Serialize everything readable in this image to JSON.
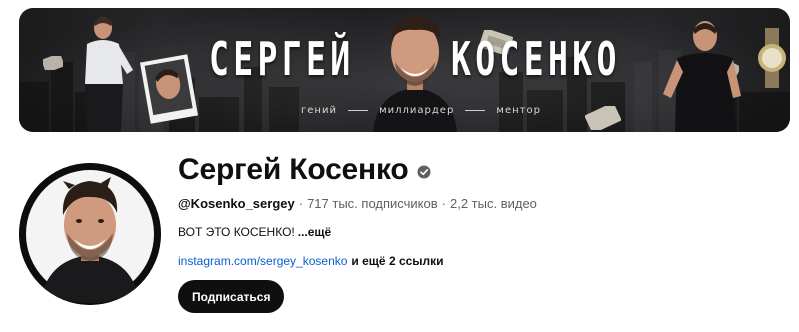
{
  "banner": {
    "title_first": "СЕРГЕЙ",
    "title_last": "КОСЕНКО",
    "tagline": [
      "гений",
      "миллиардер",
      "ментор"
    ]
  },
  "channel": {
    "name": "Сергей Косенко",
    "verified_icon": "verified-check-icon",
    "handle": "@Kosenko_sergey",
    "separator": "·",
    "subscribers": "717 тыс. подписчиков",
    "videos": "2,2 тыс. видео",
    "description": "ВОТ ЭТО КОСЕНКО!",
    "description_more": "...ещё",
    "link_text": "instagram.com/sergey_kosenko",
    "more_links": "и ещё 2 ссылки",
    "subscribe_label": "Подписаться"
  },
  "colors": {
    "text_primary": "#0f0f0f",
    "text_secondary": "#606060",
    "link": "#065fd4",
    "button_bg": "#0f0f0f",
    "button_text": "#ffffff"
  }
}
